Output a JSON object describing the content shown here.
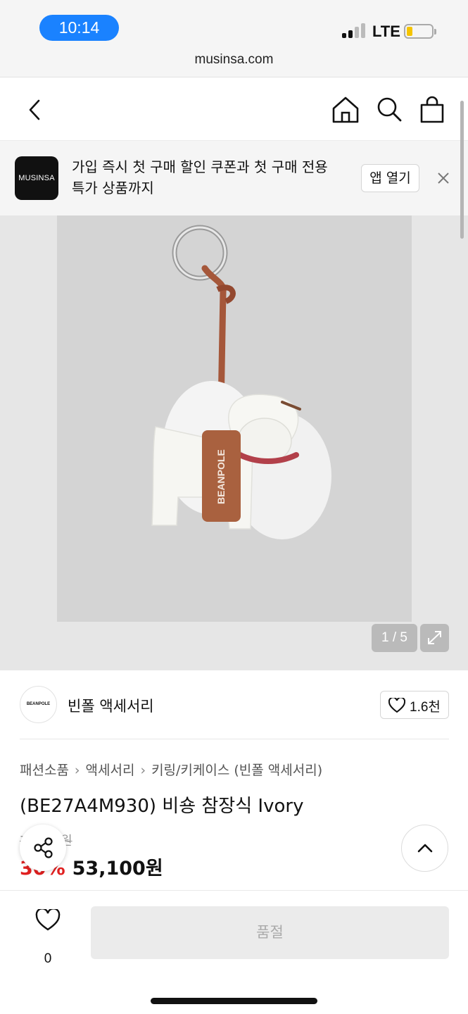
{
  "status_bar": {
    "time": "10:14",
    "network": "LTE",
    "battery_level": 0.2,
    "battery_color": "#f5c400",
    "time_pill_color": "#1a82ff"
  },
  "browser": {
    "url": "musinsa.com"
  },
  "nav": {
    "back_icon": "chevron-left-icon",
    "home_icon": "home-icon",
    "search_icon": "search-icon",
    "cart_icon": "shopping-bag-icon"
  },
  "promo": {
    "logo_text": "MUSINSA",
    "text_line1": "가입 즉시 첫 구매 할인 쿠폰과 첫 구매 전용",
    "text_line2": "특가 상품까지",
    "open_app_label": "앱 열기",
    "close_icon": "close-icon"
  },
  "gallery": {
    "counter": "1 / 5",
    "expand_icon": "expand-icon",
    "product_tag_text": "BEANPOLE"
  },
  "brand": {
    "logo_text": "BEANPOLE",
    "name": "빈폴 액세서리",
    "like_count": "1.6천"
  },
  "breadcrumb": [
    "패션소품",
    "액세서리",
    "키링/키케이스 (빈폴 액세서리)"
  ],
  "product": {
    "title": "(BE27A4M930) 비숑 참장식 Ivory",
    "original_price": "7_,_00원",
    "discount_rate": "30%",
    "price": "53,100원",
    "accent_color": "#e02020"
  },
  "bottom_bar": {
    "wish_count": "0",
    "soldout_label": "품절"
  }
}
